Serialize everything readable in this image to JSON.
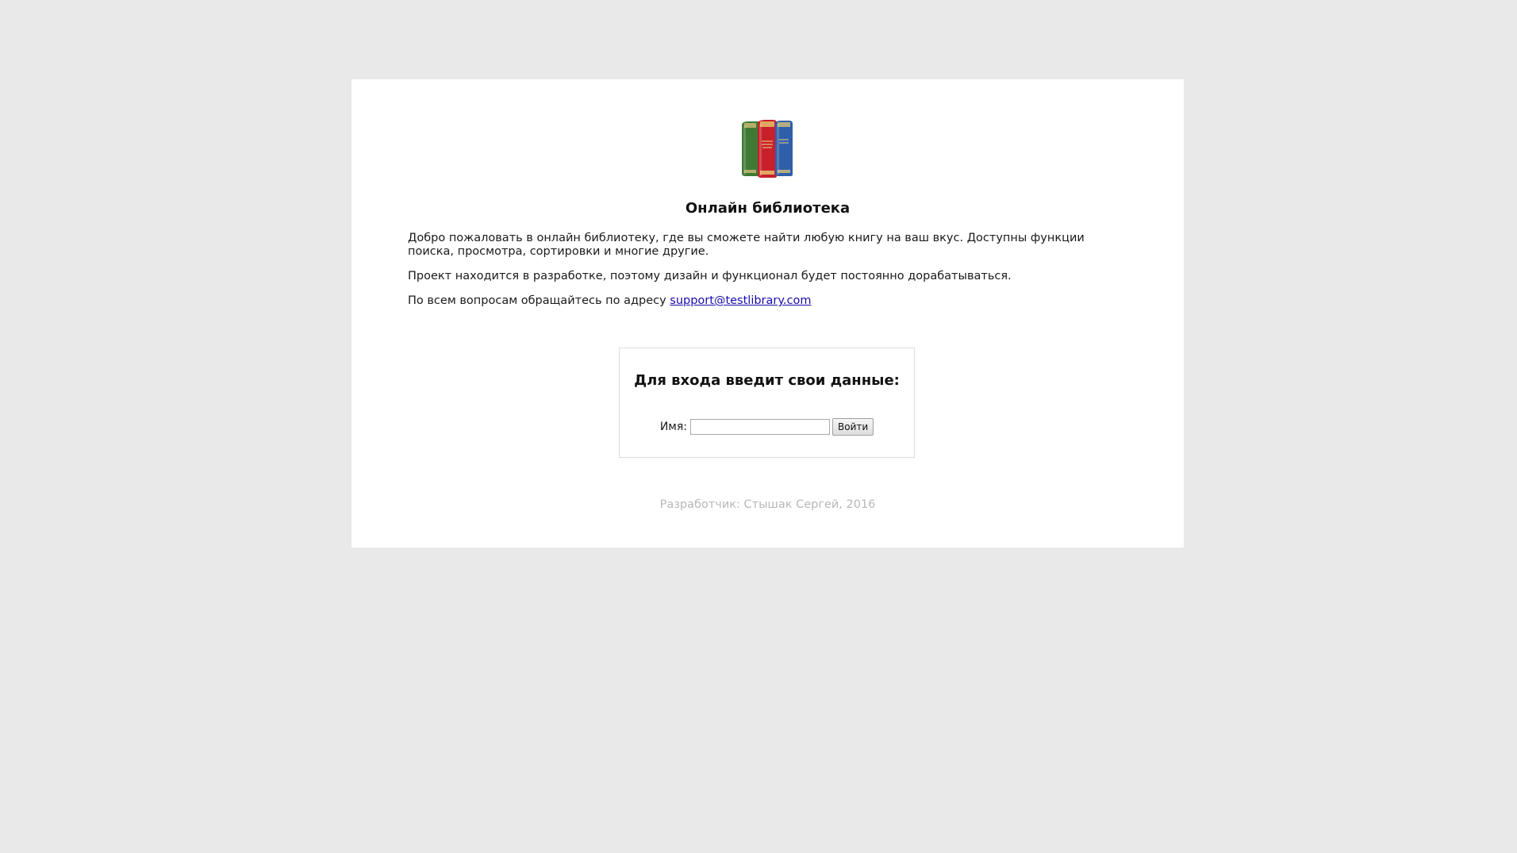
{
  "header": {
    "logo_icon": "books-icon",
    "title": "Онлайн библиотека"
  },
  "intro": {
    "paragraph1": "Добро пожаловать в онлайн библиотеку, где вы сможете найти любую книгу на ваш вкус. Доступны функции поиска, просмотра, сортировки и многие другие.",
    "paragraph2": "Проект находится в разработке, поэтому дизайн и функционал будет постоянно дорабатываться.",
    "paragraph3_prefix": "По всем вопросам обращайтесь по адресу ",
    "support_email": "support@testlibrary.com"
  },
  "login": {
    "title": "Для входа введит свои данные:",
    "name_label": "Имя:",
    "name_value": "",
    "submit_label": "Войти"
  },
  "footer": {
    "text": "Разработчик: Стышак Сергей, 2016"
  },
  "colors": {
    "page_background": "#e9e9e9",
    "panel_background": "#ffffff",
    "link": "#1a0dab",
    "footer_text": "#b8b8b8",
    "book_green": "#3f7a35",
    "book_red": "#c8202a",
    "book_blue": "#2f5fa8"
  }
}
